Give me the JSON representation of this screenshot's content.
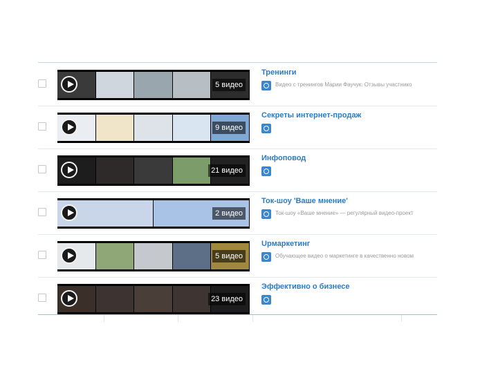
{
  "playlists": [
    {
      "title": "Тренинги",
      "description": "Видео с тренингов Марии Фаучук. Отзывы участнико",
      "count": "5 видео",
      "thumb_colors": [
        "#3a3a3a",
        "#cfd6dd",
        "#9aa6ad",
        "#b7bec4",
        "#2c2c2c"
      ]
    },
    {
      "title": "Секреты интернет-продаж",
      "description": "",
      "count": "9 видео",
      "thumb_colors": [
        "#eaeef2",
        "#f0e5c8",
        "#dde3e8",
        "#d9e6f2",
        "#7fa8d4"
      ]
    },
    {
      "title": "Инфоповод",
      "description": "",
      "count": "21 видео",
      "thumb_colors": [
        "#1d1d1d",
        "#2e2a2a",
        "#3a3a3a",
        "#7c9c6a",
        "#222222"
      ]
    },
    {
      "title": "Ток-шоу 'Ваше мнение'",
      "description": "Ток-шоу «Ваше мнение» — регулярный видео-проект",
      "count": "2 видео",
      "thumb_colors": [
        "#c9d6ea",
        "#a9c3e6"
      ]
    },
    {
      "title": "Upмаркетинг",
      "description": "Обучающее видео о маркетинге в качественно новом",
      "count": "5 видео",
      "thumb_colors": [
        "#e6e9ec",
        "#8fa676",
        "#c5c8cc",
        "#5c6f86",
        "#a0883d"
      ]
    },
    {
      "title": "Эффективно о бизнесе",
      "description": "",
      "count": "23 видео",
      "thumb_colors": [
        "#3b2f29",
        "#3d3431",
        "#4a3e38",
        "#3e3431",
        "#1d1d1d"
      ]
    }
  ]
}
